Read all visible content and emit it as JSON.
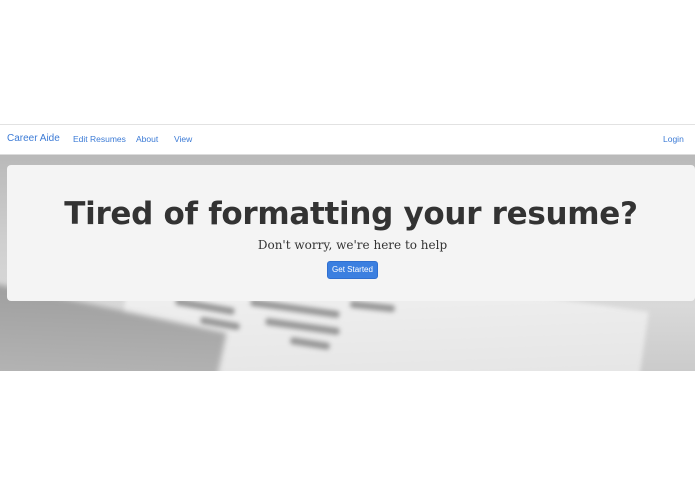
{
  "navbar": {
    "brand": "Career Aide",
    "links": [
      "Edit Resumes",
      "About",
      "View"
    ],
    "login": "Login"
  },
  "hero": {
    "title": "Tired of formatting your resume?",
    "subtitle": "Don't worry, we're here to help",
    "cta_label": "Get Started"
  },
  "colors": {
    "accent": "#3b7fe0",
    "link": "#3c7bd6",
    "jumbotron_bg": "#f4f4f4",
    "text": "#333333"
  }
}
